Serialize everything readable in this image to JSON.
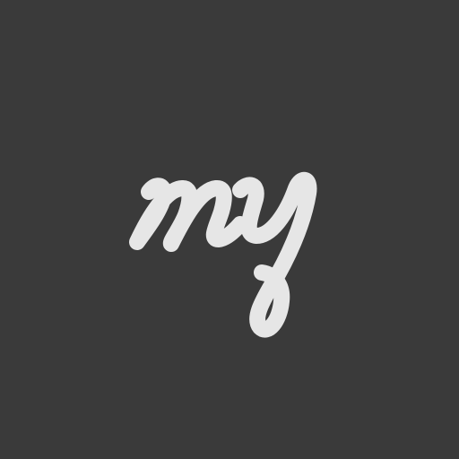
{
  "app_icon": {
    "logo_text": "my",
    "colors": {
      "background": "#3a3a3a",
      "logo": "#e6e6e6"
    }
  }
}
